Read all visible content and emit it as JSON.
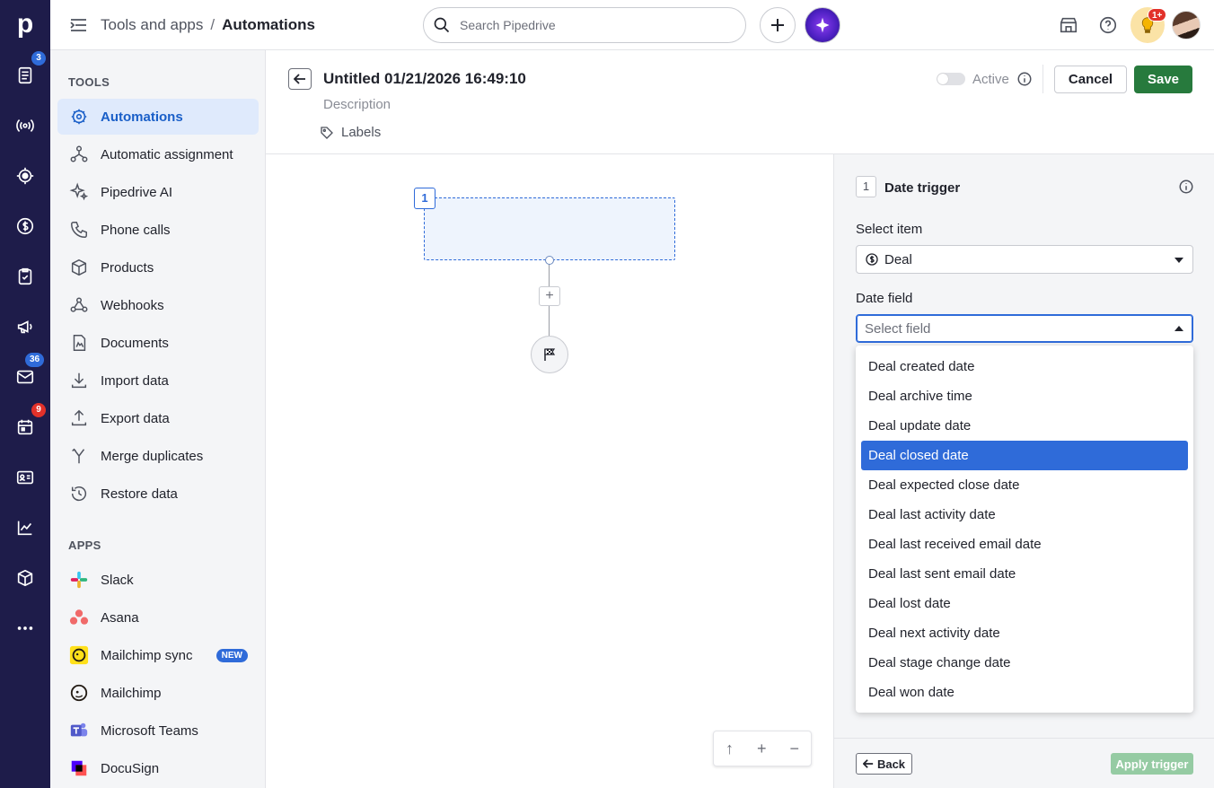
{
  "app": {
    "logo": "p",
    "brand_color": "#1e1c4a",
    "accent": "#2f6bd9",
    "save_color": "#277a3d"
  },
  "rail": {
    "items": [
      {
        "icon": "leads-icon",
        "badge": "3"
      },
      {
        "icon": "radar-icon",
        "badge": ""
      },
      {
        "icon": "target-icon",
        "badge": ""
      },
      {
        "icon": "dollar-icon",
        "badge": ""
      },
      {
        "icon": "checklist-icon",
        "badge": ""
      },
      {
        "icon": "megaphone-icon",
        "badge": ""
      },
      {
        "icon": "mail-icon",
        "badge": "36"
      },
      {
        "icon": "calendar-icon",
        "badge": "9"
      },
      {
        "icon": "contacts-card-icon",
        "badge": ""
      },
      {
        "icon": "chart-line-icon",
        "badge": ""
      },
      {
        "icon": "box-icon",
        "badge": ""
      },
      {
        "icon": "more-icon",
        "badge": ""
      }
    ]
  },
  "topbar": {
    "breadcrumb_parent": "Tools and apps",
    "breadcrumb_sep": "/",
    "breadcrumb_current": "Automations",
    "search_placeholder": "Search Pipedrive",
    "tips_badge": "1+"
  },
  "sidebar": {
    "tools_title": "TOOLS",
    "tools": [
      {
        "label": "Automations",
        "icon": "automation-icon",
        "active": true
      },
      {
        "label": "Automatic assignment",
        "icon": "assignment-icon"
      },
      {
        "label": "Pipedrive AI",
        "icon": "sparkle-icon"
      },
      {
        "label": "Phone calls",
        "icon": "phone-icon"
      },
      {
        "label": "Products",
        "icon": "product-box-icon"
      },
      {
        "label": "Webhooks",
        "icon": "webhook-icon"
      },
      {
        "label": "Documents",
        "icon": "document-icon"
      },
      {
        "label": "Import data",
        "icon": "import-icon"
      },
      {
        "label": "Export data",
        "icon": "export-icon"
      },
      {
        "label": "Merge duplicates",
        "icon": "merge-icon"
      },
      {
        "label": "Restore data",
        "icon": "restore-icon"
      }
    ],
    "apps_title": "APPS",
    "apps": [
      {
        "label": "Slack",
        "icon": "slack-icon"
      },
      {
        "label": "Asana",
        "icon": "asana-icon"
      },
      {
        "label": "Mailchimp sync",
        "icon": "mailchimp-sync-icon",
        "badge": "NEW"
      },
      {
        "label": "Mailchimp",
        "icon": "mailchimp-icon"
      },
      {
        "label": "Microsoft Teams",
        "icon": "teams-icon"
      },
      {
        "label": "DocuSign",
        "icon": "docusign-icon"
      }
    ]
  },
  "automation": {
    "title": "Untitled 01/21/2026 16:49:10",
    "description_placeholder": "Description",
    "labels": "Labels",
    "active_label": "Active",
    "cancel": "Cancel",
    "save": "Save"
  },
  "canvas": {
    "node_number": "1",
    "add_symbol": "+",
    "zoom_up": "↑",
    "zoom_in": "+",
    "zoom_out": "−"
  },
  "panel": {
    "step_number": "1",
    "title": "Date trigger",
    "select_item_label": "Select item",
    "select_item_value": "Deal",
    "date_field_label": "Date field",
    "date_field_placeholder": "Select field",
    "options": [
      "Deal created date",
      "Deal archive time",
      "Deal update date",
      "Deal closed date",
      "Deal expected close date",
      "Deal last activity date",
      "Deal last received email date",
      "Deal last sent email date",
      "Deal lost date",
      "Deal next activity date",
      "Deal stage change date",
      "Deal won date"
    ],
    "highlighted_option": "Deal closed date",
    "back": "Back",
    "apply": "Apply trigger"
  }
}
